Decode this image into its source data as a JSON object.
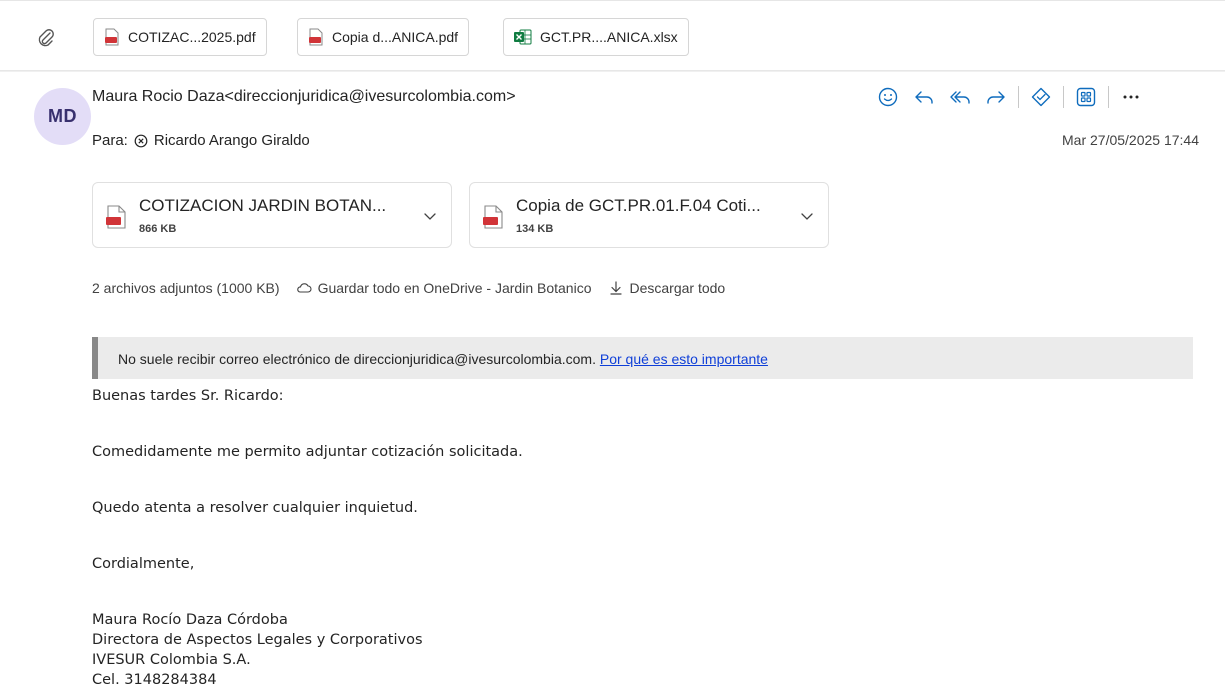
{
  "top_attachments": [
    {
      "label": "COTIZAC...2025.pdf",
      "type": "pdf"
    },
    {
      "label": "Copia d...ANICA.pdf",
      "type": "pdf"
    },
    {
      "label": "GCT.PR....ANICA.xlsx",
      "type": "xlsx"
    }
  ],
  "header": {
    "avatar_initials": "MD",
    "sender": "Maura Rocio Daza<direccionjuridica@ivesurcolombia.com>",
    "to_label": "Para:",
    "to_name": "Ricardo Arango Giraldo",
    "date": "Mar 27/05/2025 17:44"
  },
  "actions": [
    "smiley-icon",
    "reply-icon",
    "reply-all-icon",
    "forward-icon",
    "sticker-icon",
    "apps-icon",
    "more-icon"
  ],
  "attachments": [
    {
      "name": "COTIZACION JARDIN BOTAN...",
      "size": "866 KB"
    },
    {
      "name": "Copia de GCT.PR.01.F.04 Coti...",
      "size": "134 KB"
    }
  ],
  "attachment_summary": {
    "count_text": "2 archivos adjuntos (1000 KB)",
    "save_all": "Guardar todo en OneDrive - Jardin Botanico",
    "download_all": "Descargar todo"
  },
  "banner": {
    "text": "No suele recibir correo electrónico de direccionjuridica@ivesurcolombia.com.",
    "link": "Por qué es esto importante"
  },
  "body": {
    "greeting": "Buenas tardes Sr. Ricardo:",
    "line1": "Comedidamente me permito adjuntar cotización solicitada.",
    "line2": "Quedo atenta a resolver cualquier inquietud.",
    "closing": "Cordialmente,",
    "sig_name": "Maura Rocío Daza Córdoba",
    "sig_title": "Directora de Aspectos Legales y Corporativos",
    "sig_company": "IVESUR Colombia S.A.",
    "sig_phone": "Cel. 3148284384"
  },
  "colors": {
    "accent": "#0f6cbd",
    "pdf": "#d13438",
    "excel": "#107c41",
    "avatar_bg": "#e3ddf7",
    "link": "#0f3fd8"
  }
}
